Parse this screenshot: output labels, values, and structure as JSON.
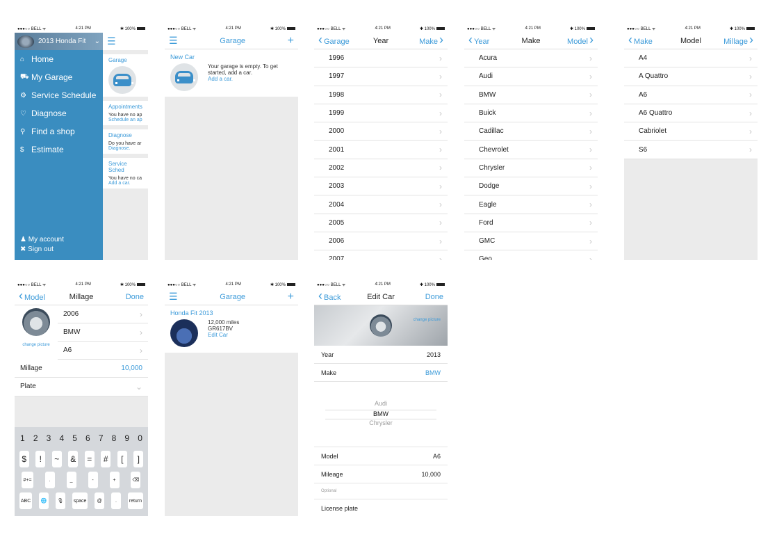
{
  "status": {
    "carrier": "●●●○○ BELL ᯤ",
    "time": "4:21 PM",
    "battery": "✱ 100%"
  },
  "menu": {
    "car": "2013 Honda Fit",
    "items": [
      {
        "icon": "⌂",
        "label": "Home"
      },
      {
        "icon": "⛟",
        "label": "My Garage"
      },
      {
        "icon": "⚙",
        "label": "Service Schedule"
      },
      {
        "icon": "♡",
        "label": "Diagnose"
      },
      {
        "icon": "⚲",
        "label": "Find a shop"
      },
      {
        "icon": "$",
        "label": "Estimate"
      }
    ],
    "account": "My account",
    "signout": "Sign out",
    "peek": {
      "garage": "Garage",
      "appointments_h": "Appointments",
      "appointments_t": "You have no ap",
      "appointments_l": "Schedule an ap",
      "diagnose_h": "Diagnose",
      "diagnose_t": "Do you have ar",
      "diagnose_l": "Diagnose.",
      "service_h": "Service Sched",
      "service_t": "You have no ca",
      "service_l": "Add a car."
    }
  },
  "garage_empty": {
    "title": "Garage",
    "section": "New Car",
    "text": "Your garage is empty. To get started, add a car.",
    "link": "Add a car."
  },
  "year": {
    "back": "Garage",
    "title": "Year",
    "next": "Make",
    "items": [
      "1996",
      "1997",
      "1998",
      "1999",
      "2000",
      "2001",
      "2002",
      "2003",
      "2004",
      "2005",
      "2006",
      "2007"
    ]
  },
  "make": {
    "back": "Year",
    "title": "Make",
    "next": "Model",
    "items": [
      "Acura",
      "Audi",
      "BMW",
      "Buick",
      "Cadillac",
      "Chevrolet",
      "Chrysler",
      "Dodge",
      "Eagle",
      "Ford",
      "GMC",
      "Geo"
    ]
  },
  "model": {
    "back": "Make",
    "title": "Model",
    "next": "Millage",
    "items": [
      "A4",
      "A Quattro",
      "A6",
      "A6 Quattro",
      "Cabriolet",
      "S6"
    ]
  },
  "millage": {
    "back": "Model",
    "title": "Millage",
    "done": "Done",
    "year": "2006",
    "make": "BMW",
    "model": "A6",
    "change_picture": "change picture",
    "millage_label": "Millage",
    "millage_value": "10,000",
    "plate_label": "Plate",
    "kb_row1": [
      "1",
      "2",
      "3",
      "4",
      "5",
      "6",
      "7",
      "8",
      "9",
      "0"
    ],
    "kb_row2": [
      "$",
      "!",
      "~",
      "&",
      "=",
      "#",
      "[",
      "]"
    ],
    "kb_row3": [
      "#+=",
      ".",
      "_",
      "-",
      "+",
      "⌫"
    ],
    "kb_row4": [
      "ABC",
      "🌐",
      "🎙",
      "space",
      "@",
      ".",
      "return"
    ]
  },
  "garage_full": {
    "title": "Garage",
    "section": "Honda Fit 2013",
    "miles": "12,000 miles",
    "plate": "GR617BV",
    "edit": "Edit Car"
  },
  "edit": {
    "back": "Back",
    "title": "Edit Car",
    "done": "Done",
    "change_picture": "change picture",
    "year_label": "Year",
    "year_value": "2013",
    "make_label": "Make",
    "make_value": "BMW",
    "picker": [
      "Audi",
      "BMW",
      "Chrysler"
    ],
    "model_label": "Model",
    "model_value": "A6",
    "mileage_label": "Mileage",
    "mileage_value": "10,000",
    "optional": "Optional",
    "plate_label": "License plate"
  },
  "colors": {
    "accent": "#3b9ad9",
    "menu": "#3a8dc0",
    "background": "#ebebeb"
  }
}
